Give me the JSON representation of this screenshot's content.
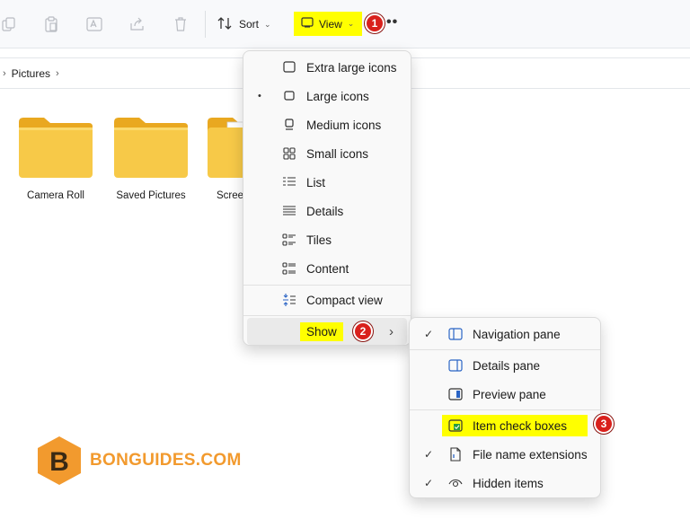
{
  "toolbar": {
    "sort_label": "Sort",
    "view_label": "View",
    "view_badge": "1",
    "more_label": "••",
    "icons": [
      "copy-icon",
      "paste-icon",
      "rename-icon",
      "share-icon",
      "delete-icon"
    ]
  },
  "address": {
    "lead_sep": "›",
    "crumb": "Pictures",
    "trail_sep": "›"
  },
  "folders": [
    {
      "label": "Camera Roll"
    },
    {
      "label": "Saved Pictures"
    },
    {
      "label": "Scree"
    }
  ],
  "view_menu": {
    "items": [
      {
        "label": "Extra large icons",
        "icon": "extra-large-icons-icon",
        "selected": false
      },
      {
        "label": "Large icons",
        "icon": "large-icons-icon",
        "selected": true
      },
      {
        "label": "Medium icons",
        "icon": "medium-icons-icon",
        "selected": false
      },
      {
        "label": "Small icons",
        "icon": "small-icons-icon",
        "selected": false
      },
      {
        "label": "List",
        "icon": "list-icon",
        "selected": false
      },
      {
        "label": "Details",
        "icon": "details-icon",
        "selected": false
      },
      {
        "label": "Tiles",
        "icon": "tiles-icon",
        "selected": false
      },
      {
        "label": "Content",
        "icon": "content-icon",
        "selected": false
      }
    ],
    "compact_label": "Compact view",
    "show_label": "Show",
    "show_badge": "2",
    "selected_marker": "•",
    "submenu_arrow": "›"
  },
  "show_menu": {
    "items": [
      {
        "label": "Navigation pane",
        "icon": "navigation-pane-icon",
        "checked": true
      },
      {
        "label": "Details pane",
        "icon": "details-pane-icon",
        "checked": false
      },
      {
        "label": "Preview pane",
        "icon": "preview-pane-icon",
        "checked": false
      },
      {
        "label": "Item check boxes",
        "icon": "item-check-boxes-icon",
        "checked": false
      },
      {
        "label": "File name extensions",
        "icon": "file-extensions-icon",
        "checked": true
      },
      {
        "label": "Hidden items",
        "icon": "hidden-items-icon",
        "checked": true
      }
    ],
    "check_mark": "✓",
    "badge": "3"
  },
  "logo": {
    "letter": "B",
    "text": "BONGUIDES.COM"
  },
  "colors": {
    "highlight": "#ffff00",
    "badge": "#d9201c",
    "folder": "#f7c948",
    "logo": "#f29a2e"
  }
}
